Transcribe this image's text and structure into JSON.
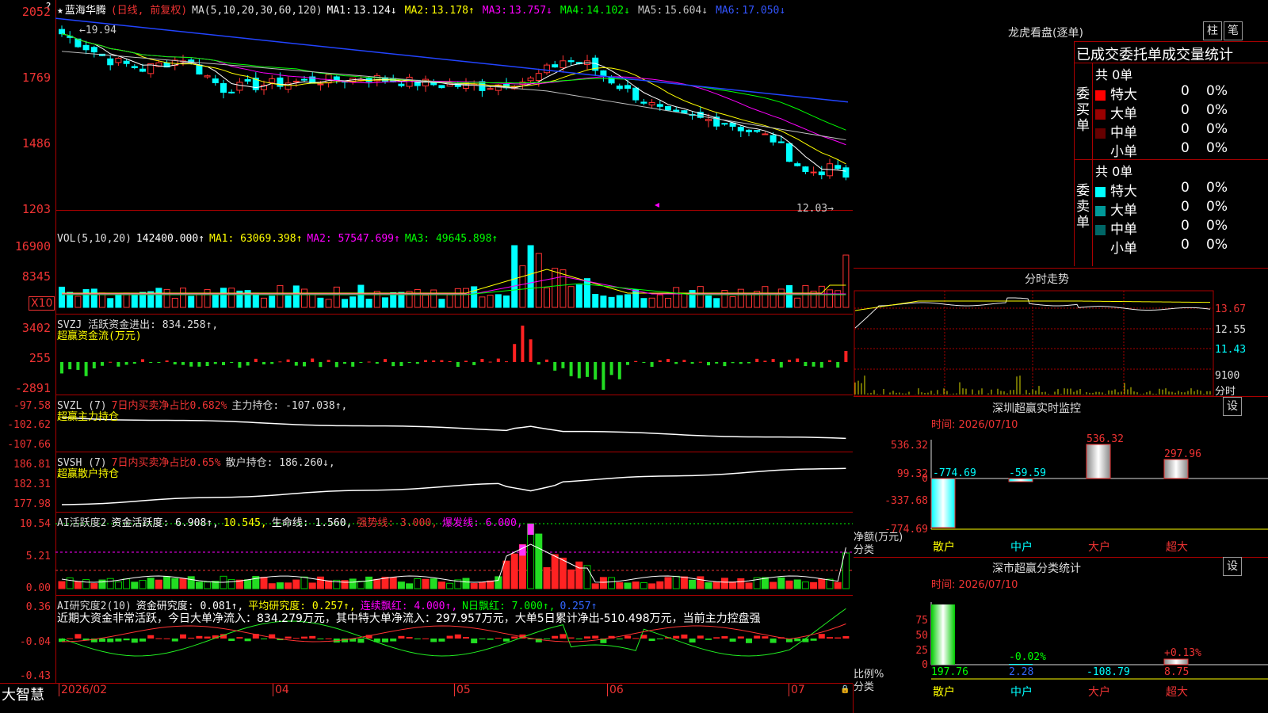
{
  "main": {
    "stock_name": "蓝海华腾",
    "period_label": "(日线, 前复权)",
    "ma_label": "MA(5,10,20,30,60,120)",
    "ma": [
      {
        "label": "MA1:",
        "value": "13.124↓",
        "color": "#ffffff"
      },
      {
        "label": "MA2:",
        "value": "13.178↑",
        "color": "#ffff00"
      },
      {
        "label": "MA3:",
        "value": "13.757↓",
        "color": "#ff00ff"
      },
      {
        "label": "MA4:",
        "value": "14.102↓",
        "color": "#00ff00"
      },
      {
        "label": "MA5:",
        "value": "15.604↓",
        "color": "#c0c0c0"
      },
      {
        "label": "MA6:",
        "value": "17.050↓",
        "color": "#3355ff"
      }
    ],
    "yticks": [
      "2052",
      "1769",
      "1486",
      "1203"
    ],
    "high_annotation": "19.94",
    "low_annotation": "12.03"
  },
  "vol": {
    "header": "VOL(5,10,20)",
    "value": "142400.000↑",
    "ma1": "MA1: 63069.398↑",
    "ma2": "MA2: 57547.699↑",
    "ma3": "MA3: 49645.898↑",
    "yticks": [
      "16900",
      "8345"
    ],
    "unit": "X10"
  },
  "svzj": {
    "header": "SVZJ  活跃资金进出: 834.258↑,",
    "sub": "超赢资金流(万元)",
    "yticks": [
      "3402",
      "255",
      "-2891"
    ]
  },
  "svzl": {
    "header_a": "SVZL (7)",
    "header_b": "7日内买卖净占比0.682%",
    "header_c": "主力持仓: -107.038↑,",
    "sub": "超赢主力持仓",
    "yticks": [
      "-97.58",
      "-102.62",
      "-107.66"
    ]
  },
  "svsh": {
    "header_a": "SVSH (7)",
    "header_b": "7日内买卖净占比0.65%",
    "header_c": "散户持仓: 186.260↓,",
    "sub": "超赢散户持仓",
    "yticks": [
      "186.81",
      "182.31",
      "177.98"
    ]
  },
  "ai1": {
    "header_a": "AI活跃度2",
    "header_b": "资金活跃度: 6.908↑,",
    "header_c": "10.545,",
    "header_d": "生命线: 1.560,",
    "header_e": "强势线: 3.000,",
    "header_f": "爆发线: 6.000,",
    "yticks": [
      "10.54",
      "5.21",
      "0.00"
    ]
  },
  "ai2": {
    "header_a": "AI研究度2(10)",
    "header_b": "资金研究度: 0.081↑,",
    "header_c": "平均研究度: 0.257↑,",
    "header_d": "连续飘红: 4.000↑,",
    "header_e": "N日飘红: 7.000↑,",
    "header_f": "0.257↑",
    "comment": "近期大资金非常活跃，今日大单净流入：834.279万元，其中特大单净流入：297.957万元，大单5日累计净出-510.498万元，当前主力控盘强",
    "yticks": [
      "0.36",
      "-0.04",
      "-0.43"
    ]
  },
  "bottom_axis": {
    "brand": "大智慧",
    "labels": [
      "2026/02",
      "04",
      "05",
      "06",
      "07"
    ]
  },
  "right": {
    "lhkp_title": "龙虎看盘(逐单)",
    "btn_zhu": "柱",
    "btn_bi": "笔",
    "tabs": "已成交委托单成交量统计",
    "buy_side": "委买单",
    "sell_side": "委卖单",
    "buy_total": "共 0单",
    "sell_total": "共 0单",
    "buy_rows": [
      {
        "name": "特大",
        "count": "0",
        "pct": "0%",
        "color": "#ff0000"
      },
      {
        "name": "大单",
        "count": "0",
        "pct": "0%",
        "color": "#990000"
      },
      {
        "name": "中单",
        "count": "0",
        "pct": "0%",
        "color": "#660000"
      },
      {
        "name": "小单",
        "count": "0",
        "pct": "0%",
        "color": "#000000"
      }
    ],
    "sell_rows": [
      {
        "name": "特大",
        "count": "0",
        "pct": "0%",
        "color": "#00ffff"
      },
      {
        "name": "大单",
        "count": "0",
        "pct": "0%",
        "color": "#009999"
      },
      {
        "name": "中单",
        "count": "0",
        "pct": "0%",
        "color": "#006666"
      },
      {
        "name": "小单",
        "count": "0",
        "pct": "0%",
        "color": "#000000"
      }
    ],
    "fs_title": "分时走势",
    "fs_yticks": [
      "13.67",
      "12.55",
      "11.43"
    ],
    "fs_vol": "9100",
    "fs_vol_unit": "分时",
    "sz_title": "深圳超赢实时监控",
    "sz_btn": "设",
    "sz_time": "时间: 2026/07/10",
    "sz_yticks": [
      "536.32",
      "99.32",
      "0",
      "-337.68",
      "-774.69"
    ],
    "sz_unit": "净额(万元)",
    "sz_cat_label": "分类",
    "sz_cats": [
      "散户",
      "中户",
      "大户",
      "超大"
    ],
    "sz_values": [
      "-774.69",
      "-59.59",
      "536.32",
      "297.96"
    ],
    "ss_title": "深市超赢分类统计",
    "ss_btn": "设",
    "ss_time": "时间: 2026/07/10",
    "ss_yticks": [
      "75",
      "50",
      "25",
      "0"
    ],
    "ss_unit": "比例%",
    "ss_cat_label": "分类",
    "ss_cats": [
      "散户",
      "中户",
      "大户",
      "超大"
    ],
    "ss_labels_top": [
      "-0.02%",
      "+0.13%"
    ],
    "ss_values": [
      "197.76",
      "2.28",
      "-108.79",
      "8.75"
    ]
  }
}
